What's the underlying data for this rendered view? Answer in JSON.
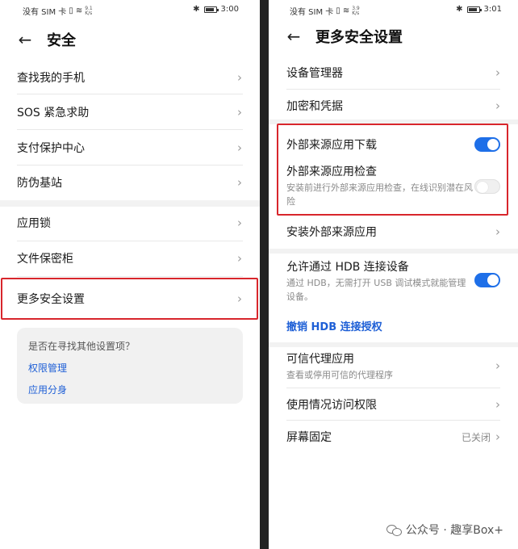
{
  "left": {
    "statusbar": {
      "carrier": "没有 SIM 卡",
      "netspeed": "9.1 K/s",
      "time": "3:00"
    },
    "header": {
      "title": "安全"
    },
    "items": [
      {
        "label": "查找我的手机"
      },
      {
        "label": "SOS 紧急求助"
      },
      {
        "label": "支付保护中心"
      },
      {
        "label": "防伪基站"
      },
      {
        "label": "应用锁"
      },
      {
        "label": "文件保密柜"
      },
      {
        "label": "更多安全设置"
      }
    ],
    "suggest": {
      "title": "是否在寻找其他设置项？",
      "links": [
        "权限管理",
        "应用分身"
      ]
    }
  },
  "right": {
    "statusbar": {
      "carrier": "没有 SIM 卡",
      "netspeed": "3.9 K/s",
      "time": "3:01"
    },
    "header": {
      "title": "更多安全设置"
    },
    "device_admin": "设备管理器",
    "encryption": "加密和凭据",
    "external_download": {
      "label": "外部来源应用下载",
      "enabled": true
    },
    "external_check": {
      "label": "外部来源应用检查",
      "sub": "安装前进行外部来源应用检查，在线识别潜在风险",
      "enabled": false
    },
    "install_external": "安装外部来源应用",
    "hdb": {
      "label": "允许通过 HDB 连接设备",
      "sub": "通过 HDB，无需打开 USB 调试模式就能管理设备。",
      "enabled": true
    },
    "revoke_hdb": "撤销 HDB 连接授权",
    "trust_agents": {
      "label": "可信代理应用",
      "sub": "查看或停用可信的代理程序"
    },
    "usage_access": "使用情况访问权限",
    "screen_pinning": {
      "label": "屏幕固定",
      "value": "已关闭"
    }
  },
  "watermark": "公众号 · 趣享Box+",
  "colors": {
    "accent": "#1e6fe8",
    "link": "#1e5fd6",
    "highlight": "#d8262c"
  },
  "icons": [
    "back-arrow-icon",
    "chevron-right-icon",
    "bluetooth-icon",
    "battery-icon",
    "wifi-icon",
    "sim-icon",
    "wechat-icon"
  ]
}
